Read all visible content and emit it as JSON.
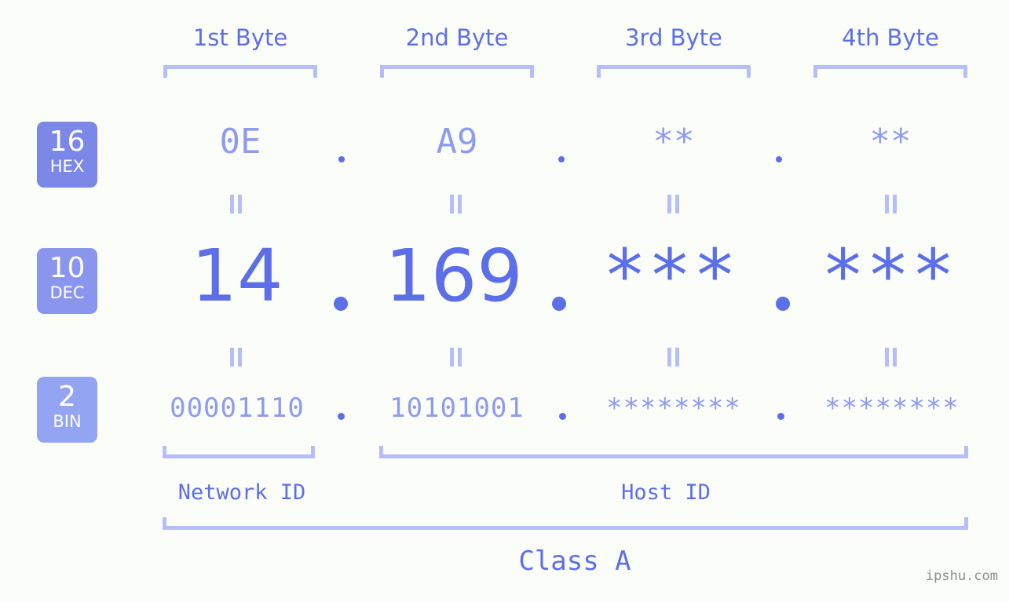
{
  "watermark": "ipshu.com",
  "byte_headers": [
    {
      "label": "1st Byte"
    },
    {
      "label": "2nd Byte"
    },
    {
      "label": "3rd Byte"
    },
    {
      "label": "4th Byte"
    }
  ],
  "bases": [
    {
      "number": "16",
      "name": "HEX",
      "color": "#7b88e8"
    },
    {
      "number": "10",
      "name": "DEC",
      "color": "#8a96ee"
    },
    {
      "number": "2",
      "name": "BIN",
      "color": "#93a5f2"
    }
  ],
  "rows": {
    "hex": {
      "base_number": "16",
      "base_name": "HEX",
      "values": [
        "0E",
        "A9",
        "**",
        "**"
      ],
      "separator": "."
    },
    "dec": {
      "base_number": "10",
      "base_name": "DEC",
      "values": [
        "14",
        "169",
        "***",
        "***"
      ],
      "separator": "."
    },
    "bin": {
      "base_number": "2",
      "base_name": "BIN",
      "values": [
        "00001110",
        "10101001",
        "********",
        "********"
      ],
      "separator": "."
    }
  },
  "connectors": {
    "symbol": "="
  },
  "segments": {
    "network_id": "Network ID",
    "host_id": "Host ID"
  },
  "class": {
    "label": "Class A"
  },
  "colors": {
    "background": "#fbfdf8",
    "accent_strong": "#5c6fe8",
    "accent_mid": "#8d9bf0",
    "accent_light": "#b5bdfa",
    "watermark_gray": "#8a8f8a"
  }
}
